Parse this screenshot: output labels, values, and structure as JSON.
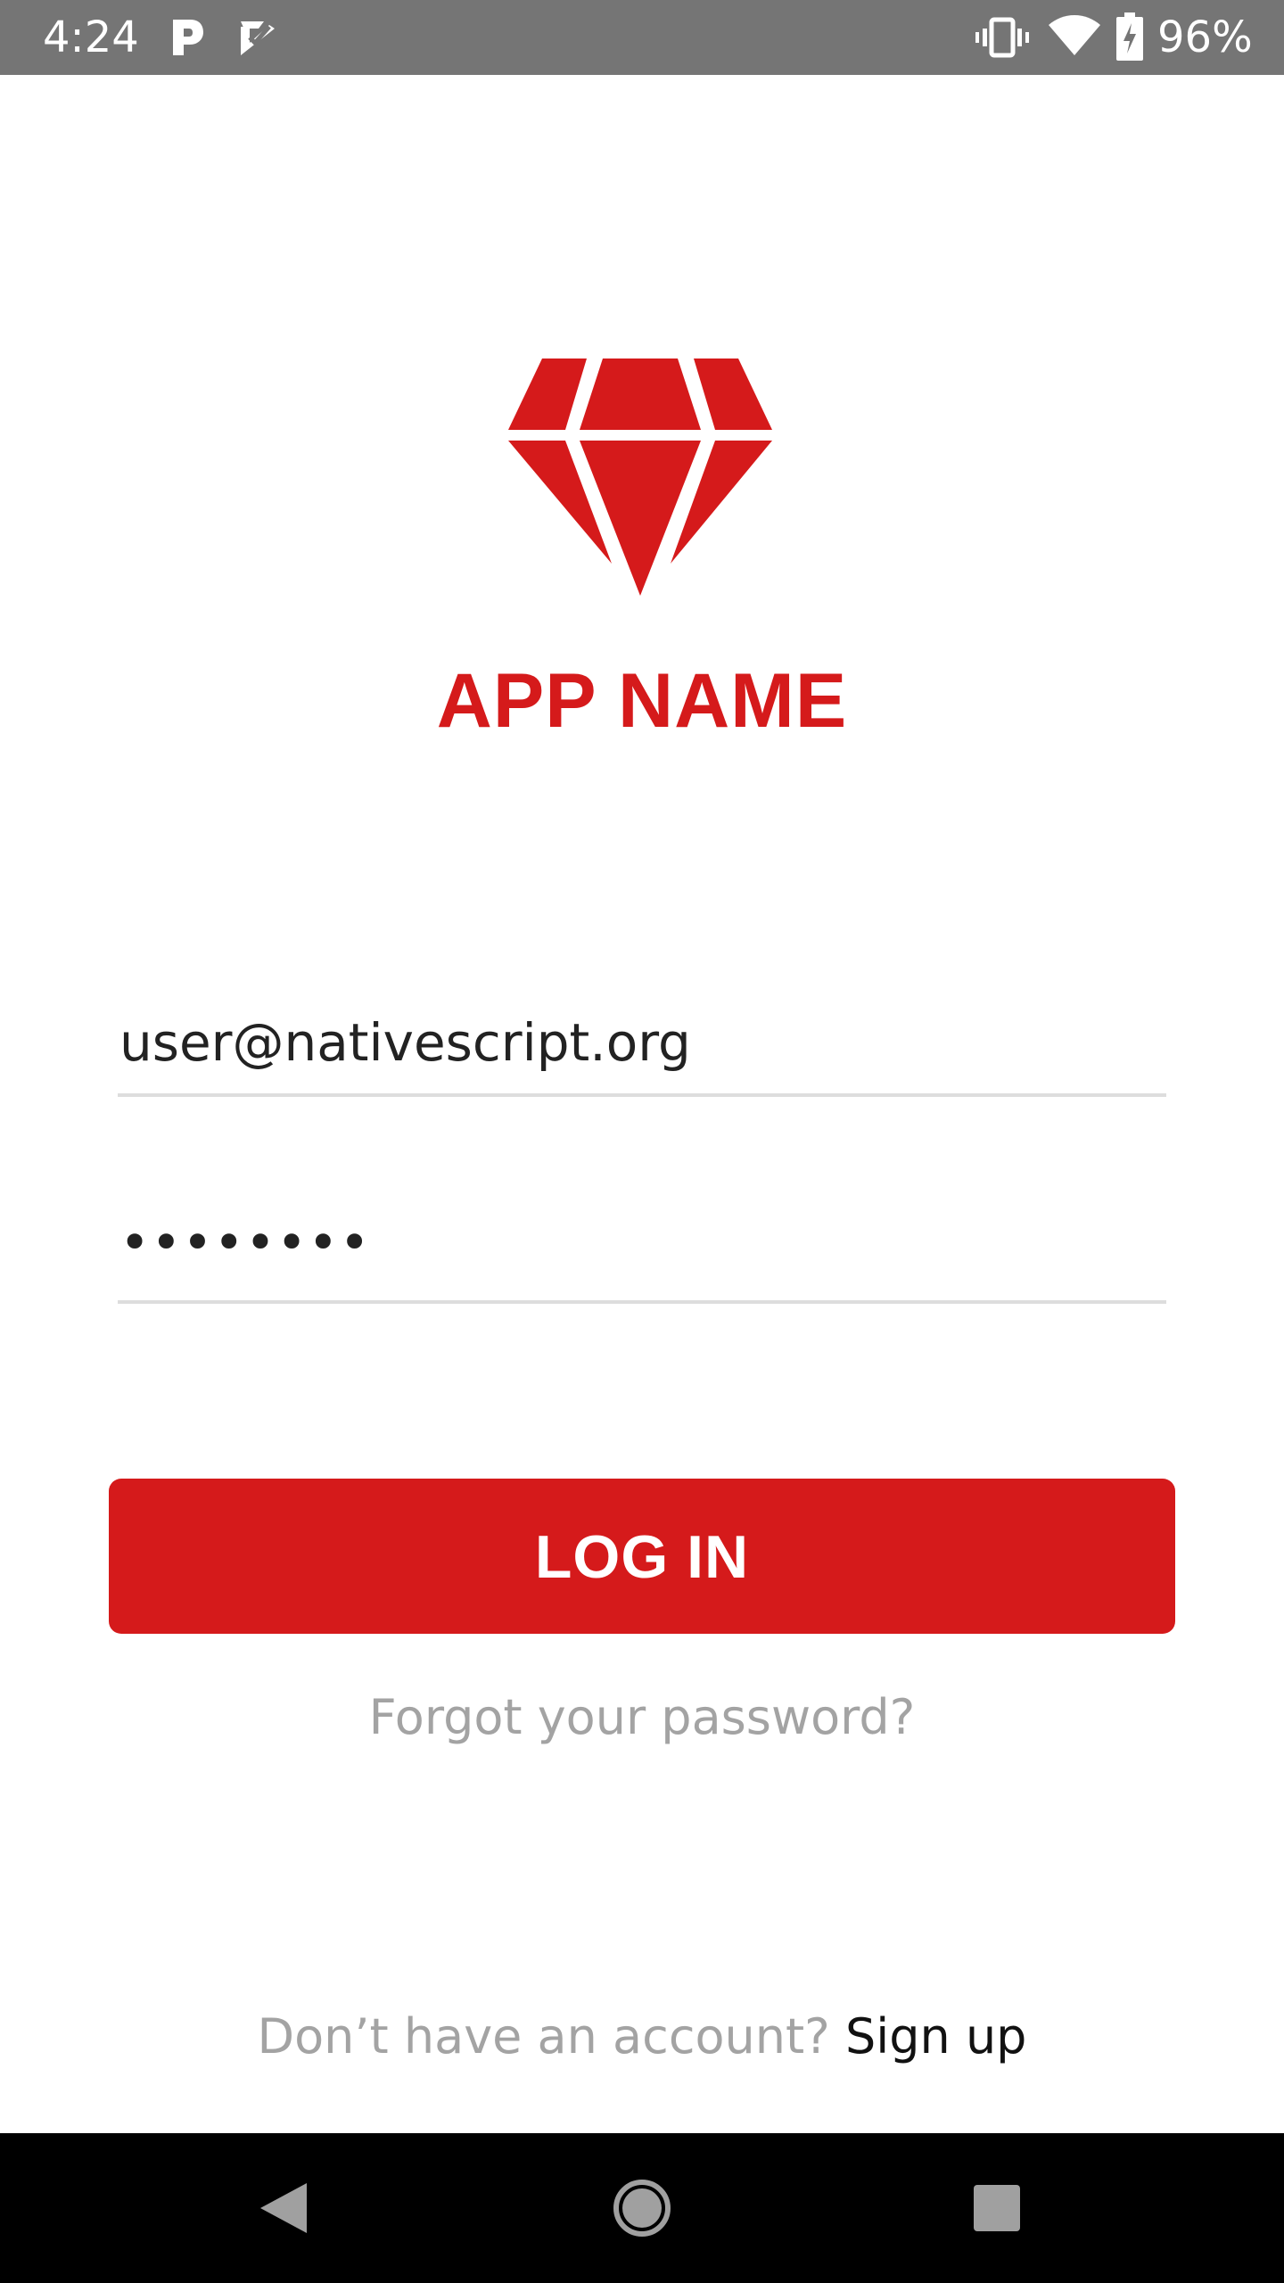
{
  "status_bar": {
    "time": "4:24",
    "battery_percent": "96%",
    "icons": [
      "parking-app-icon",
      "checkmark-app-icon",
      "vibrate-icon",
      "wifi-icon",
      "battery-charging-icon"
    ]
  },
  "branding": {
    "logo_icon": "diamond-logo-icon",
    "app_name": "APP NAME",
    "accent_color": "#d51a1b"
  },
  "login_form": {
    "email_value": "user@nativescript.org",
    "password_masked": "••••••••",
    "login_button_label": "LOG IN",
    "forgot_password_label": "Forgot your password?"
  },
  "footer": {
    "signup_prompt": "Don’t have an account?",
    "signup_link": "Sign up"
  },
  "nav_bar": {
    "icons": [
      "back-icon",
      "home-icon",
      "recents-icon"
    ]
  }
}
